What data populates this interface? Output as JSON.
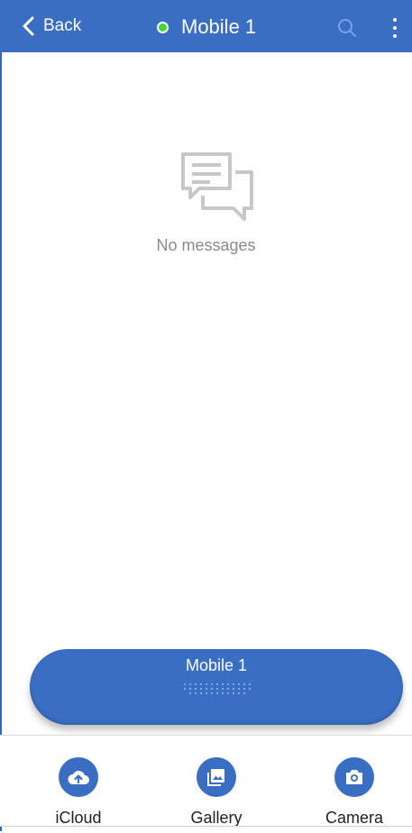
{
  "header": {
    "back_label": "Back",
    "title": "Mobile 1",
    "status_color": "#46d13b",
    "bg_color": "#3a6ec3"
  },
  "empty": {
    "icon": "chat-bubbles-icon",
    "text": "No messages"
  },
  "pill": {
    "label": "Mobile 1"
  },
  "actions": [
    {
      "label": "iCloud",
      "icon": "cloud-upload-icon"
    },
    {
      "label": "Gallery",
      "icon": "image-icon"
    },
    {
      "label": "Camera",
      "icon": "camera-icon"
    }
  ]
}
